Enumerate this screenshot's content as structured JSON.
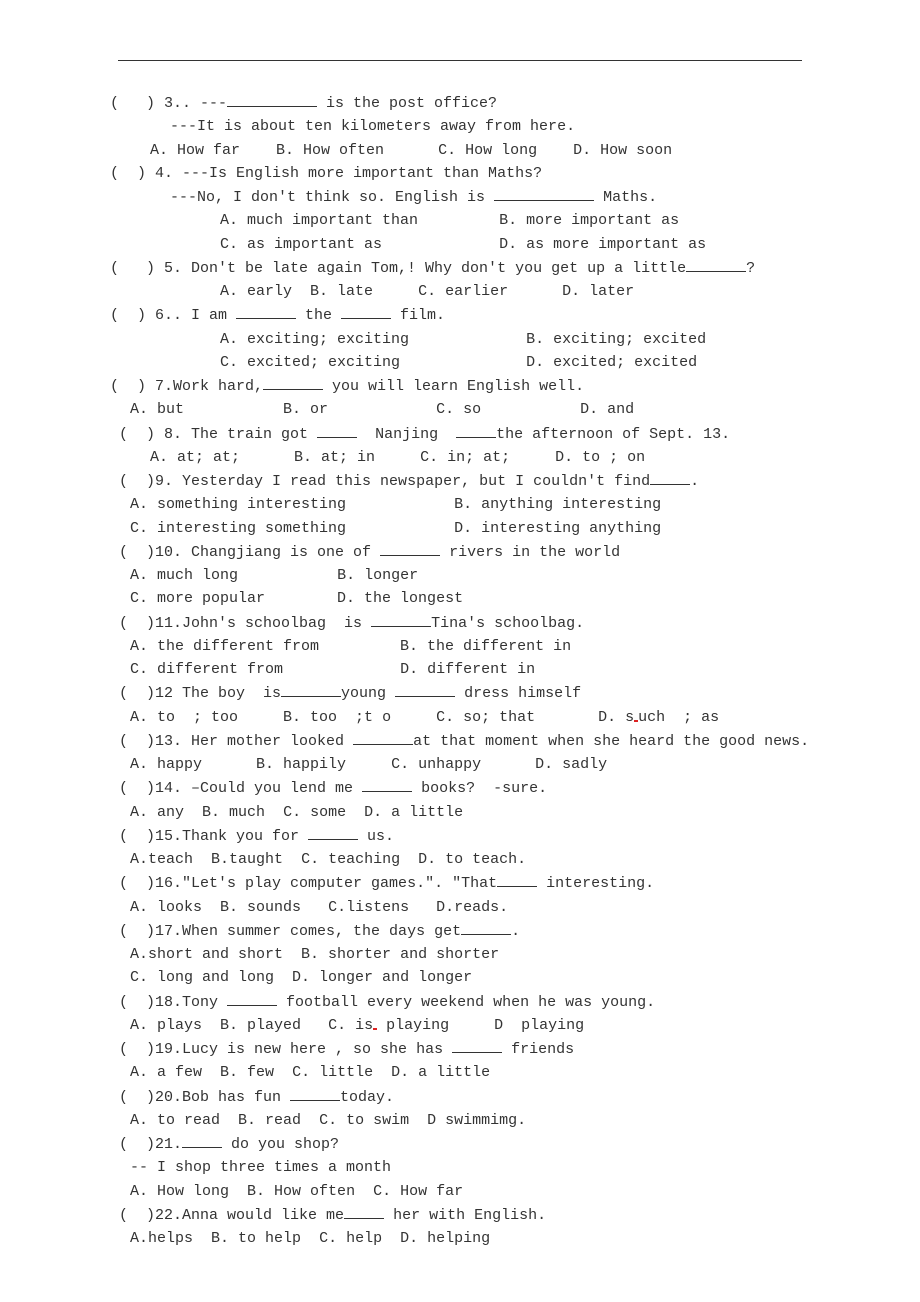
{
  "q3": {
    "num": "(   ) 3.. ---",
    "prompt_a": " is the post office?",
    "line2": "---It is about ten kilometers away from here.",
    "A": "A. How far",
    "B": "B. How often",
    "C": "C. How long",
    "D": "D. How soon"
  },
  "q4": {
    "num": "(  ) 4. ---Is English more important than Maths?",
    "line2": "---No, I don't think so. English is ",
    "line2b": " Maths.",
    "A": "A. much important than",
    "B": "B. more important as",
    "C": "C. as important as",
    "D": "D. as more important as"
  },
  "q5": {
    "num": "(   ) 5. Don't be late again Tom,! Why don't you get up a little",
    "tail": "?",
    "A": "A. early",
    "B": "B. late",
    "C": "C. earlier",
    "D": "D. later"
  },
  "q6": {
    "num": "(  ) 6.. I am ",
    "mid": " the ",
    "tail": " film.",
    "A": "A. exciting; exciting",
    "B": "B. exciting; excited",
    "C": "C. excited; exciting",
    "D": "D. excited; excited"
  },
  "q7": {
    "num": "(  ) 7.Work hard,",
    "tail": " you will learn English well.",
    "A": "A. but",
    "B": "B. or",
    "C": "C. so",
    "D": "D. and"
  },
  "q8": {
    "num": " (  ) 8. The train got ",
    "mid": "  Nanjing  ",
    "tail": "the afternoon of Sept. 13.",
    "A": "A. at; at;",
    "B": "B. at; in",
    "C": "C. in; at;",
    "D": "D. to ; on"
  },
  "q9": {
    "num": " (  )9. Yesterday I read this newspaper, but I couldn't find",
    "tail": ".",
    "A": "A. something interesting",
    "B": "B. anything interesting",
    "C": "C. interesting something",
    "D": "D. interesting anything"
  },
  "q10": {
    "num": " (  )10. Changjiang is one of ",
    "tail": " rivers in the world",
    "A": "A. much long",
    "B": "B. longer",
    "C": "C. more popular",
    "D": "D. the longest"
  },
  "q11": {
    "num": " (  )11.John's schoolbag  is ",
    "tail": "Tina's schoolbag.",
    "A": "A. the different from",
    "B": "B. the different in",
    "C": "C. different from",
    "D": "D. different in"
  },
  "q12": {
    "num": " (  )12 The boy  is",
    "mid": "young ",
    "tail": " dress himself",
    "A": "A. to  ; too",
    "B": "B. too  ;t o",
    "C": "C. so; that",
    "D": "D. s",
    "D2": "uch  ; as"
  },
  "q13": {
    "num": " (  )13. Her mother looked ",
    "tail": "at that moment when she heard the good news.",
    "A": "A. happy",
    "B": "B. happily",
    "C": "C. unhappy",
    "D": "D. sadly"
  },
  "q14": {
    "num": " (  )14. –Could you lend me ",
    "tail": " books?  -sure.",
    "A": "A. any",
    "B": "B. much",
    "C": "C. some",
    "D": "D. a little"
  },
  "q15": {
    "num": " (  )15.Thank you for ",
    "tail": " us.",
    "A": "A.teach",
    "B": "B.taught",
    "C": "C. teaching",
    "D": "D. to teach."
  },
  "q16": {
    "num": " (  )16.\"Let's play computer games.\". \"That",
    "tail": " interesting.",
    "A": "A. looks",
    "B": "B. sounds",
    "C": "C.listens",
    "D": "D.reads."
  },
  "q17": {
    "num": " (  )17.When summer comes, the days get",
    "tail": ".",
    "A": "A.short and short",
    "B": "B. shorter and shorter",
    "C": "C. long and long",
    "D": "D. longer and longer"
  },
  "q18": {
    "num": " (  )18.Tony ",
    "tail": " football every weekend when he was young.",
    "A": "A. plays",
    "B": "B. played",
    "C": "C. is",
    "C2": " playing",
    "D": "D  playing"
  },
  "q19": {
    "num": " (  )19.Lucy is new here , so she has ",
    "tail": " friends",
    "A": "A. a few",
    "B": "B. few",
    "C": "C. little",
    "D": "D. a little"
  },
  "q20": {
    "num": " (  )20.Bob has fun ",
    "tail": "today.",
    "A": "A. to read",
    "B": "B. read",
    "C": "C. to swim",
    "D": "D swimmimg."
  },
  "q21": {
    "num": " (  )21.",
    "tail": " do you shop?",
    "line2": "-- I shop three times a month",
    "A": "A. How long",
    "B": "B. How often",
    "C": "C. How far"
  },
  "q22": {
    "num": " (  )22.Anna would like me",
    "tail": " her with English.",
    "A": "A.helps",
    "B": "B. to help",
    "C": "C. help",
    "D": "D. helping"
  }
}
